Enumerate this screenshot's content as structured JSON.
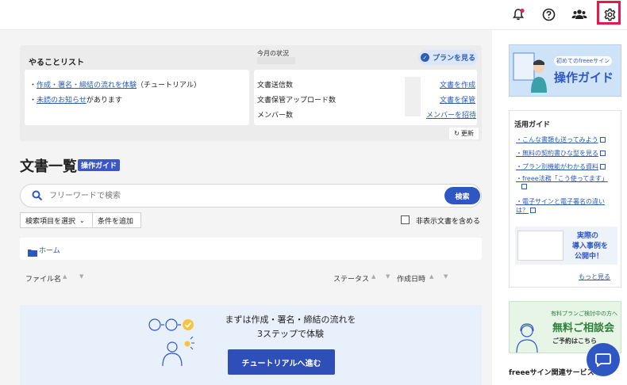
{
  "header": {
    "icons": [
      "bell-icon",
      "help-icon",
      "team-icon",
      "gear-icon"
    ]
  },
  "todo": {
    "title": "やることリスト",
    "items": [
      {
        "link": "作成・署名・締結の流れを体験",
        "rest": "（チュートリアル）"
      },
      {
        "link": "未読のお知らせ",
        "rest": "があります"
      }
    ]
  },
  "status": {
    "title": "今月の状況",
    "plan_label": "プランを見る",
    "rows": [
      {
        "label": "文書送信数",
        "action": "文書を作成"
      },
      {
        "label": "文書保管アップロード数",
        "action": "文書を保管"
      },
      {
        "label": "メンバー数",
        "action": "メンバーを招待"
      }
    ],
    "refresh_label": "更新"
  },
  "documents": {
    "title": "文書一覧",
    "guide_badge": "操作ガイド",
    "search_placeholder": "フリーワードで検索",
    "search_button": "検索",
    "select_filter_label": "検索項目を選択",
    "add_condition_label": "条件を追加",
    "hidden_checkbox_label": "非表示文書を含める",
    "breadcrumb_home": "ホーム",
    "columns": [
      "ファイル名",
      "ステータス",
      "作成日時"
    ]
  },
  "tutorial": {
    "line1": "まずは作成・署名・締結の流れを",
    "line2": "3ステップで体験",
    "button": "チュートリアルへ進む"
  },
  "sidebar": {
    "banner_small": "初めてのfreeeサイン",
    "banner_big": "操作ガイド",
    "guide_title": "活用ガイド",
    "guide_items": [
      "こんな書類も送ってみよう",
      "無料の契約書ひな型を見る",
      "プラン別機能がわかる資料",
      "freee法務「こう使ってます」",
      "電子サインと電子署名の違いは？"
    ],
    "case_lines": [
      "実際の",
      "導入事例を",
      "公開中！"
    ],
    "more_label": "もっと見る",
    "consult_small": "有料プランご検討中の方へ",
    "consult_big": "無料ご相談会",
    "consult_link": "ご予約はこちら",
    "related_title": "freeeサイン関連サービス"
  },
  "colors": {
    "accent": "#2f57c4",
    "highlight": "#e6194b",
    "notification_dot": "#e0245e"
  }
}
